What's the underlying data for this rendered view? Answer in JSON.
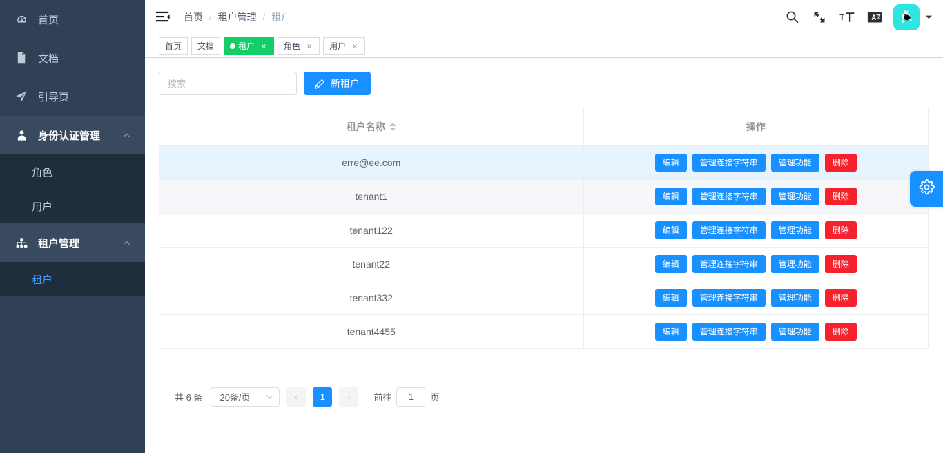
{
  "sidebar": {
    "items": [
      {
        "label": "首页",
        "icon": "dashboard-icon",
        "type": "link"
      },
      {
        "label": "文档",
        "icon": "document-icon",
        "type": "link"
      },
      {
        "label": "引导页",
        "icon": "guide-icon",
        "type": "link"
      },
      {
        "label": "身份认证管理",
        "icon": "user-icon",
        "type": "group",
        "expanded": true,
        "children": [
          {
            "label": "角色"
          },
          {
            "label": "用户"
          }
        ]
      },
      {
        "label": "租户管理",
        "icon": "tree-icon",
        "type": "group",
        "expanded": true,
        "active": true,
        "children": [
          {
            "label": "租户",
            "active": true
          }
        ]
      }
    ]
  },
  "navbar": {
    "hamburger_icon": "hamburger-icon",
    "breadcrumb": [
      {
        "label": "首页",
        "current": false
      },
      {
        "label": "租户管理",
        "current": false
      },
      {
        "label": "租户",
        "current": true
      }
    ],
    "separator": "/",
    "icons": [
      {
        "name": "search-icon"
      },
      {
        "name": "fullscreen-icon"
      },
      {
        "name": "font-size-icon"
      },
      {
        "name": "translate-icon"
      }
    ],
    "avatar": {
      "name": "user-avatar",
      "bg": "#2ee6e0"
    },
    "caret": "chevron-down-icon"
  },
  "tags": [
    {
      "label": "首页",
      "active": false,
      "closable": false
    },
    {
      "label": "文档",
      "active": false,
      "closable": false
    },
    {
      "label": "租户",
      "active": true,
      "closable": true
    },
    {
      "label": "角色",
      "active": false,
      "closable": true
    },
    {
      "label": "用户",
      "active": false,
      "closable": true
    }
  ],
  "tag_close_glyph": "×",
  "toolbar": {
    "search_placeholder": "搜索",
    "search_value": "",
    "new_tenant_label": "新租户",
    "new_tenant_icon": "edit-pencil-icon"
  },
  "table": {
    "columns": [
      {
        "key": "name",
        "label": "租户名称",
        "sortable": true
      },
      {
        "key": "actions",
        "label": "操作",
        "sortable": false
      }
    ],
    "action_labels": {
      "edit": "编辑",
      "manage_connection_string": "管理连接字符串",
      "manage_features": "管理功能",
      "delete": "删除"
    },
    "rows": [
      {
        "name": "erre@ee.com",
        "state": "hover"
      },
      {
        "name": "tenant1",
        "state": "stripe"
      },
      {
        "name": "tenant122",
        "state": "normal"
      },
      {
        "name": "tenant22",
        "state": "normal"
      },
      {
        "name": "tenant332",
        "state": "normal"
      },
      {
        "name": "tenant4455",
        "state": "normal"
      }
    ]
  },
  "pagination": {
    "total_text": "共 6 条",
    "page_size_label": "20条/页",
    "prev_glyph": "‹",
    "next_glyph": "›",
    "current_page": "1",
    "jump_prefix": "前往",
    "jump_value": "1",
    "jump_suffix": "页"
  },
  "settings_handle": {
    "icon": "gear-icon"
  },
  "colors": {
    "sidebar_bg": "#304156",
    "submenu_bg": "#1f2d3d",
    "accent_blue": "#1890ff",
    "active_tag_green": "#13ce66",
    "danger_red": "#f5222d",
    "menu_active_text": "#409eff",
    "row_hover": "#e8f4fd",
    "row_stripe": "#f5f7fa"
  }
}
